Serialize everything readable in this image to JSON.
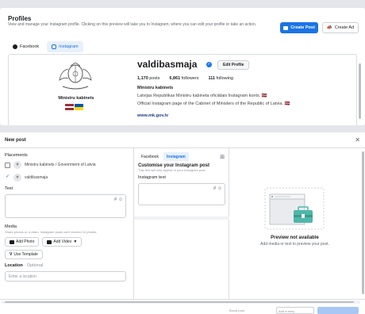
{
  "profiles": {
    "title": "Profiles",
    "description": "View and manage your Instagram profile. Clicking on this preview will take you to Instagram, where you can edit your profile or take an action.",
    "create_post": "Create Post",
    "create_ad": "Create Ad",
    "tabs": [
      {
        "label": "Facebook"
      },
      {
        "label": "Instagram"
      }
    ],
    "card": {
      "page_name": "Ministru kabinets",
      "username": "valdibasmaja",
      "edit_profile": "Edit Profile",
      "posts_count": "1,170",
      "posts_label": "posts",
      "followers_count": "6,861",
      "followers_label": "followers",
      "following_count": "111",
      "following_label": "following",
      "bio_name": "Ministru kabinets",
      "bio_line1": "Latvijas Republikas Ministru kabineta oficiālais Instagram konts. 🇱🇻",
      "bio_line2": "Official Instagram page of the Cabinet of Ministers of the Republic of Latvia. 🇱🇻",
      "website": "www.mk.gov.lv"
    }
  },
  "new_post": {
    "title": "New post",
    "placements_label": "Placements",
    "placements": [
      {
        "label": "Ministru kabinets / Government of Latvia",
        "checked": false
      },
      {
        "label": "valdibasmaja",
        "checked": true
      }
    ],
    "text_label": "Text",
    "media_label": "Media",
    "media_sub": "Share photos or a video. Instagram posts can't exceed 10 photos.",
    "add_photo": "Add Photo",
    "add_video": "Add Video",
    "use_template": "Use Template",
    "location_label": "Location",
    "location_optional": " · Optional",
    "location_placeholder": "Enter a location",
    "customize": {
      "tabs": [
        {
          "label": "Facebook"
        },
        {
          "label": "Instagram"
        }
      ],
      "title": "Customise your Instagram post",
      "sub": "This text will only appear in your Instagram post.",
      "text_label": "Instagram text"
    },
    "preview": {
      "title": "Preview not available",
      "sub": "Add media or text to preview your post."
    },
    "footer": {
      "left_text": "Boost post",
      "right_text": "Add a story"
    }
  },
  "colors": {
    "accent": "#1b74e4",
    "lv_red": "#9e3039",
    "ua_blue": "#0057b7",
    "ua_yellow": "#ffd700"
  }
}
